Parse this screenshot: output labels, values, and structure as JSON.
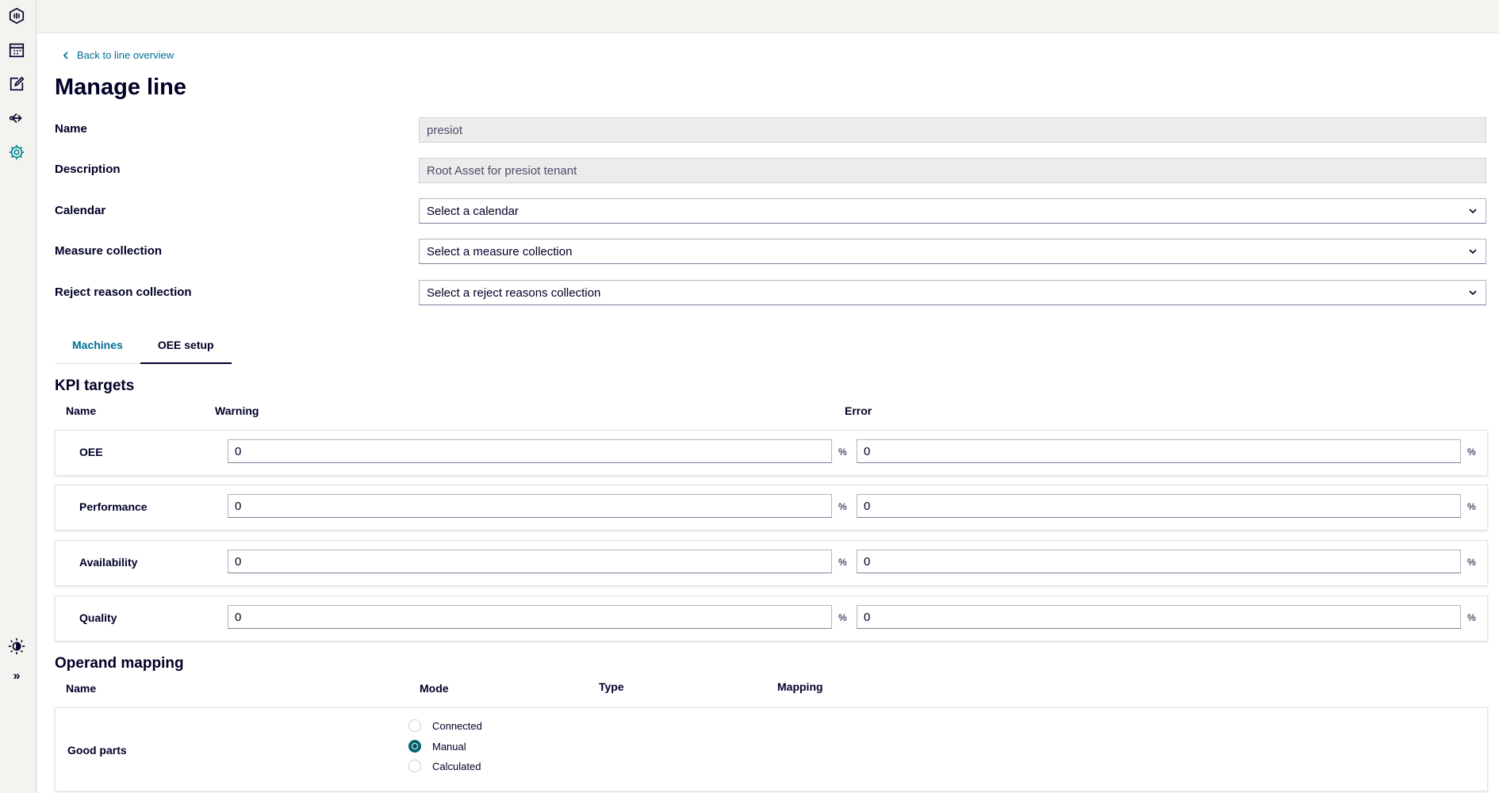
{
  "sidebar": {
    "items": [
      {
        "icon": "hexagon-logo-icon"
      },
      {
        "icon": "calendar-icon"
      },
      {
        "icon": "edit-icon"
      },
      {
        "icon": "share-icon"
      },
      {
        "icon": "gear-icon",
        "active": true
      }
    ],
    "bottom": [
      {
        "icon": "theme-icon"
      },
      {
        "icon": "expand-icon",
        "label": "»"
      }
    ]
  },
  "header": {
    "back_link": "Back to line overview",
    "title": "Manage line"
  },
  "form": {
    "name_label": "Name",
    "name_value": "presiot",
    "description_label": "Description",
    "description_value": "Root Asset for presiot tenant",
    "calendar_label": "Calendar",
    "calendar_value": "Select a calendar",
    "measure_label": "Measure collection",
    "measure_value": "Select a measure collection",
    "reject_label": "Reject reason collection",
    "reject_value": "Select a reject reasons collection"
  },
  "tabs": [
    {
      "label": "Machines",
      "active": false
    },
    {
      "label": "OEE setup",
      "active": true
    }
  ],
  "kpi": {
    "title": "KPI targets",
    "col_name": "Name",
    "col_warning": "Warning",
    "col_error": "Error",
    "unit": "%",
    "rows": [
      {
        "name": "OEE",
        "warning": "0",
        "error": "0"
      },
      {
        "name": "Performance",
        "warning": "0",
        "error": "0"
      },
      {
        "name": "Availability",
        "warning": "0",
        "error": "0"
      },
      {
        "name": "Quality",
        "warning": "0",
        "error": "0"
      }
    ]
  },
  "operand": {
    "title": "Operand mapping",
    "col_name": "Name",
    "col_mode": "Mode",
    "col_type": "Type",
    "col_mapping": "Mapping",
    "rows": [
      {
        "name": "Good parts",
        "modes": [
          "Connected",
          "Manual",
          "Calculated"
        ],
        "selected_mode": "Manual"
      }
    ]
  },
  "colors": {
    "accent": "#006e93",
    "active_icon": "#00848f",
    "radio_selected": "#00646e",
    "text": "#000028"
  }
}
